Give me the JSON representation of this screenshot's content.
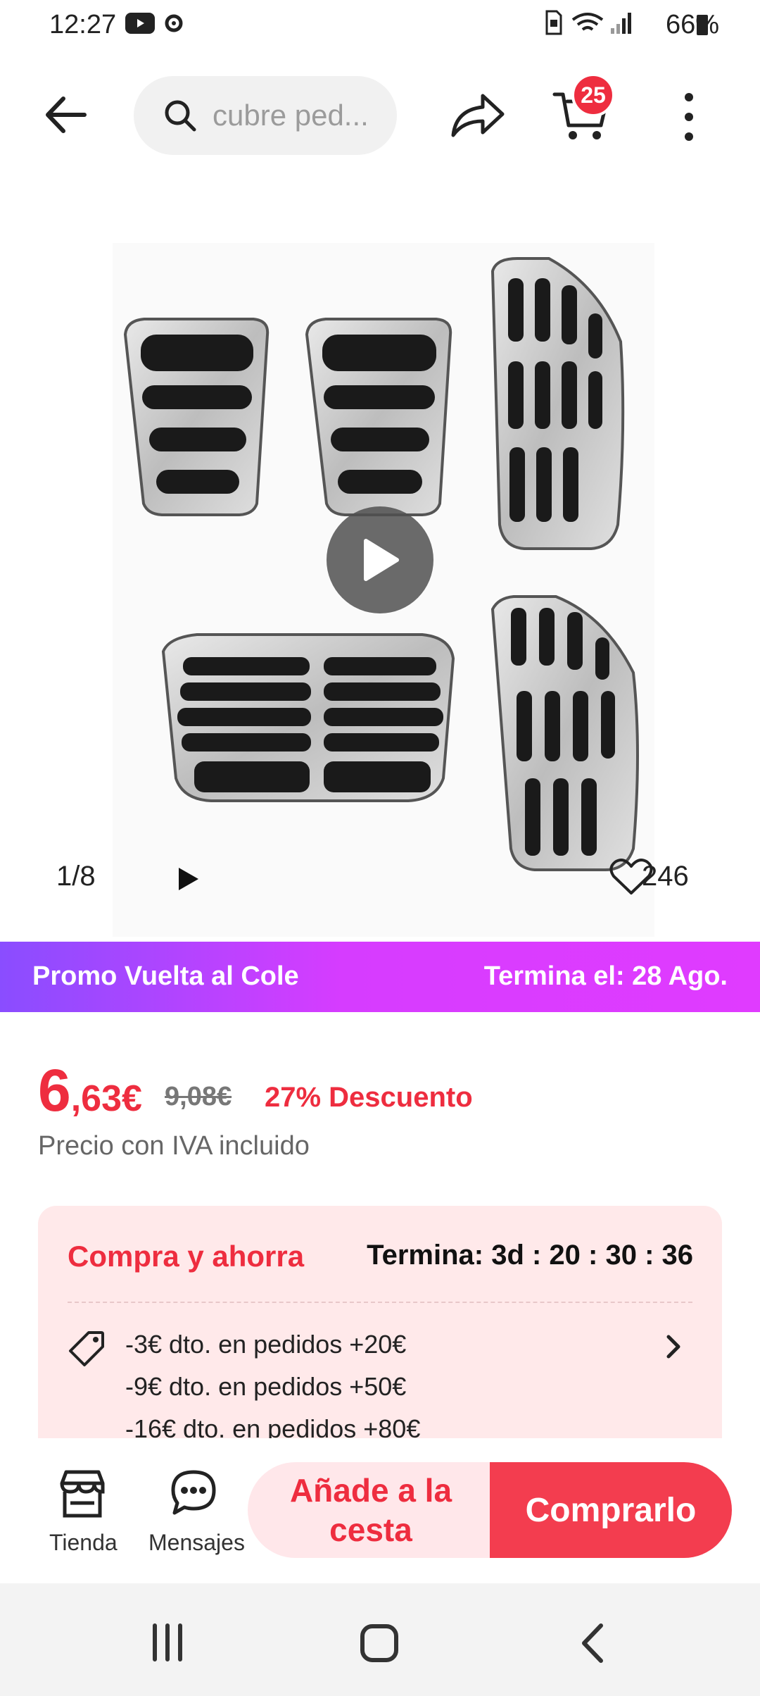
{
  "status_bar": {
    "time": "12:27",
    "battery": "66%"
  },
  "header": {
    "search_placeholder": "cubre ped...",
    "cart_count": "25"
  },
  "media": {
    "counter": "1/8",
    "likes": "246"
  },
  "promo": {
    "left": "Promo Vuelta al Cole",
    "right": "Termina el: 28 Ago."
  },
  "price": {
    "integer": "6",
    "decimal": ",63€",
    "original": "9,08€",
    "discount": "27% Descuento",
    "tax_note": "Precio con IVA incluido"
  },
  "save": {
    "title": "Compra y ahorra",
    "ends_label": "Termina:",
    "countdown": "3d : 20 : 30 : 36",
    "offers": [
      "-3€ dto. en pedidos +20€",
      "-9€ dto. en pedidos +50€",
      "-16€ dto. en pedidos +80€"
    ]
  },
  "actions": {
    "shop": "Tienda",
    "messages": "Mensajes",
    "add_to_cart": "Añade a la cesta",
    "buy": "Comprarlo"
  },
  "colors": {
    "accent": "#ee2d3f",
    "promo_start": "#8a4dff",
    "promo_end": "#e03bff",
    "save_bg": "#ffe9ea"
  }
}
